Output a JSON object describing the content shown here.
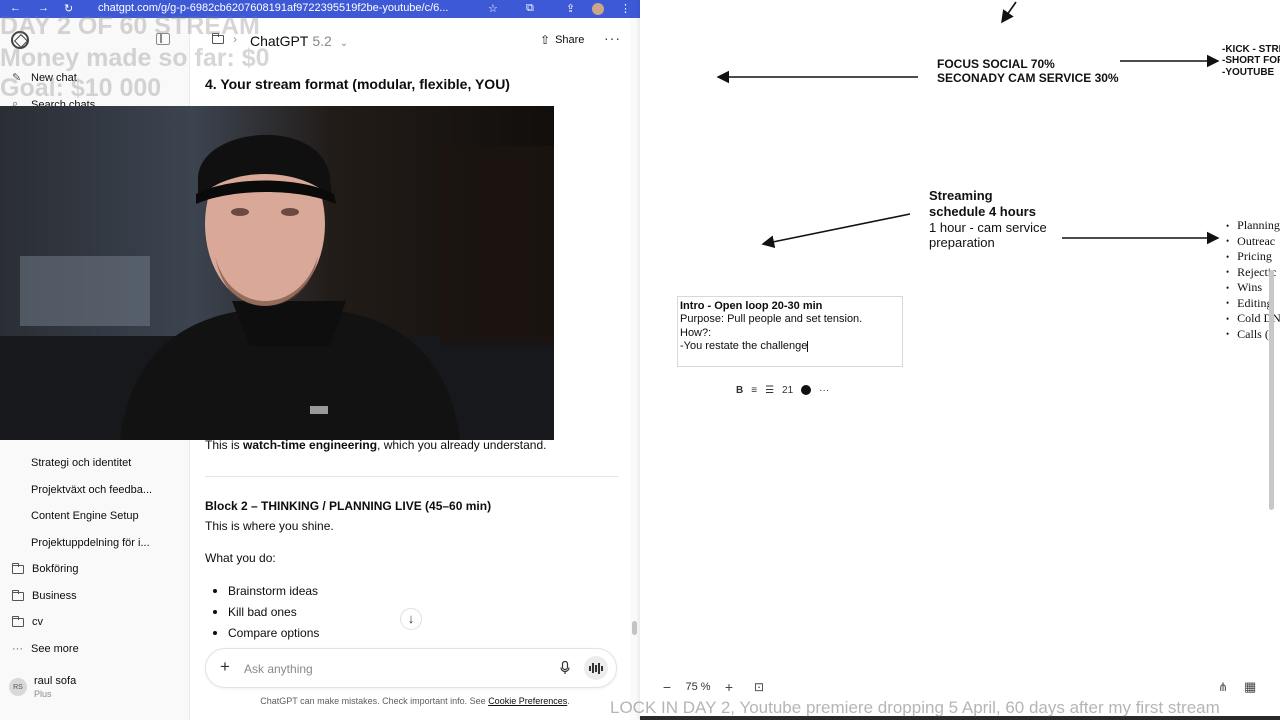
{
  "browser": {
    "url": "chatgpt.com/g/g-p-6982cb6207608191af9722395519f2be-youtube/c/6..."
  },
  "overlay": {
    "line1": "DAY 2 OF 60 STREAM",
    "line2": "Money made so far: $0",
    "line3": "Goal: $10 000",
    "ticker": "LOCK IN DAY 2, Youtube premiere dropping 5 April, 60 days after my first stream"
  },
  "sidebar": {
    "new_chat": "New chat",
    "search_chats": "Search chats",
    "project_chats": [
      "Strategi och identitet",
      "Projektväxt och feedba...",
      "Content Engine Setup",
      "Projektuppdelning för i..."
    ],
    "folders": [
      "Bokföring",
      "Business",
      "cv"
    ],
    "see_more": "See more",
    "user": {
      "initials": "RS",
      "name": "raul sofa",
      "plan": "Plus"
    }
  },
  "header": {
    "model": "ChatGPT",
    "version": "5.2",
    "share": "Share"
  },
  "chat": {
    "section_title": "4. Your stream format (modular, flexible, YOU)",
    "watch_time_pre": "This is ",
    "watch_time_bold": "watch-time engineering",
    "watch_time_post": ", which you already understand.",
    "block2_title": "Block 2 – THINKING / PLANNING LIVE (45–60 min)",
    "block2_sub": "This is where you shine.",
    "what_you_do": "What you do:",
    "bullets": [
      "Brainstorm ideas",
      "Kill bad ones",
      "Compare options"
    ],
    "composer_placeholder": "Ask anything",
    "disclaimer_pre": "ChatGPT can make mistakes. Check important info. See ",
    "disclaimer_link": "Cookie Preferences",
    "disclaimer_post": "."
  },
  "board": {
    "focus_line1": "FOCUS SOCIAL 70%",
    "focus_line2": "SECONADY CAM SERVICE 30%",
    "platforms": [
      "-KICK - STRE",
      "-SHORT FOR",
      "-YOUTUBE"
    ],
    "streaming_line1": "Streaming",
    "streaming_line2": "schedule 4 hours",
    "streaming_line3": "1 hour - cam service",
    "streaming_line4": "preparation",
    "schedule_list": [
      "Planning",
      "Outreac",
      "Pricing",
      "Rejectic",
      "Wins",
      "Editing",
      "Cold DN",
      "Calls (f"
    ],
    "intro_title": "Intro - Open loop 20-30 min",
    "intro_purpose": "Purpose: Pull people and set tension.",
    "intro_how": "How?:",
    "intro_point": "-You restate the challenge",
    "toolbar_size": "21",
    "zoom": "75 %"
  }
}
